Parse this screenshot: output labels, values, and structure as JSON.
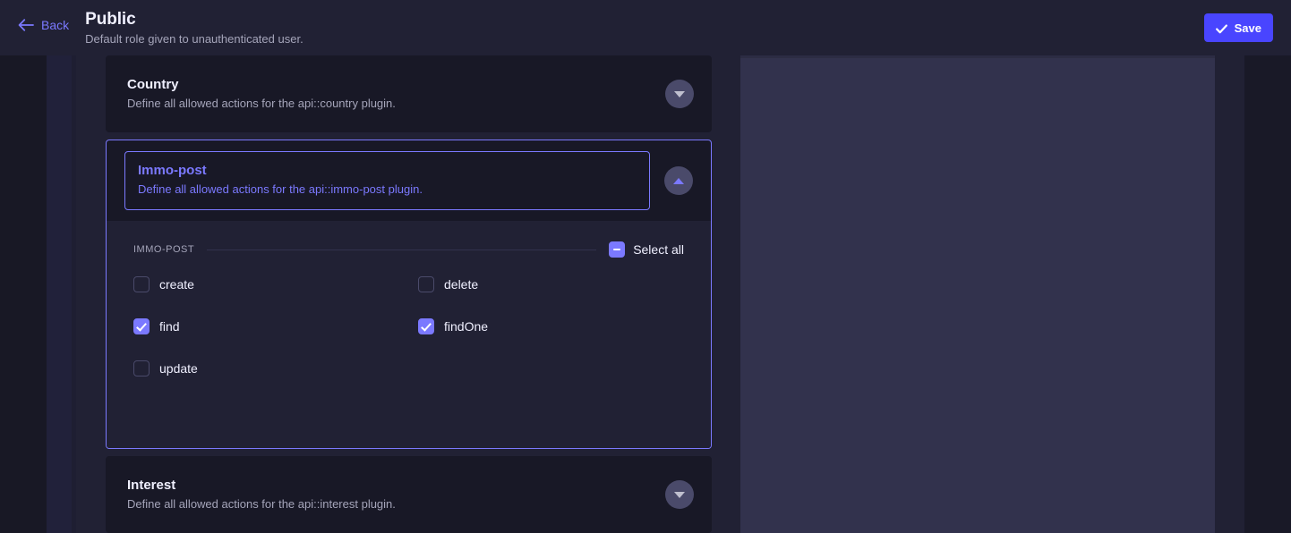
{
  "header": {
    "back_label": "Back",
    "back_icon": "arrow-left-icon",
    "title": "Public",
    "subtitle": "Default role given to unauthenticated user.",
    "save_label": "Save",
    "save_icon": "check-icon"
  },
  "colors": {
    "accent": "#4945ff",
    "accent_light": "#7b79ff",
    "page_bg": "#181826",
    "panel_bg": "#212134",
    "card_bg": "#181826",
    "right_panel_bg": "#32324d",
    "text_primary": "#f0f0ff",
    "text_muted": "#a5a5ba",
    "toggle_bg": "#4a4a6a"
  },
  "sections": [
    {
      "id": "country",
      "title": "Country",
      "description": "Define all allowed actions for the api::country plugin.",
      "expanded": false,
      "toggle_icon": "chevron-down-icon"
    },
    {
      "id": "immo-post",
      "title": "Immo-post",
      "description": "Define all allowed actions for the api::immo-post plugin.",
      "expanded": true,
      "focused": true,
      "toggle_icon": "chevron-up-icon",
      "body": {
        "legend_label": "IMMO-POST",
        "select_all_label": "Select all",
        "select_all_state": "indeterminate",
        "permissions": [
          {
            "label": "create",
            "checked": false
          },
          {
            "label": "delete",
            "checked": false
          },
          {
            "label": "find",
            "checked": true
          },
          {
            "label": "findOne",
            "checked": true
          },
          {
            "label": "update",
            "checked": false
          }
        ]
      }
    },
    {
      "id": "interest",
      "title": "Interest",
      "description": "Define all allowed actions for the api::interest plugin.",
      "expanded": false,
      "toggle_icon": "chevron-down-icon"
    }
  ]
}
